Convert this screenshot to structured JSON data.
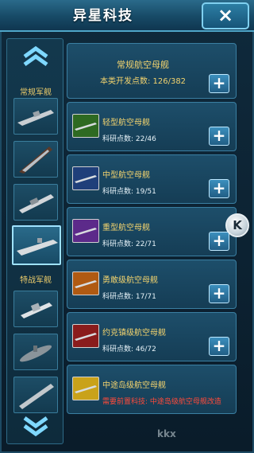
{
  "window": {
    "title": "异星科技",
    "close_label": "×"
  },
  "sidebar": {
    "up_arrow_icon": "chevron-up-double",
    "down_arrow_icon": "chevron-down-double",
    "categories": [
      {
        "label": "常规军舰"
      },
      {
        "label": "特战军舰"
      }
    ],
    "selected_index": 3
  },
  "header": {
    "name": "常规航空母舰",
    "points": "本类开发点数: 126/382",
    "plus_label": "+"
  },
  "ships": [
    {
      "name": "轻型航空母舰",
      "points": "科研点数: 22/46",
      "thumb_color": "#2e6a22",
      "plus_label": "+"
    },
    {
      "name": "中型航空母舰",
      "points": "科研点数: 19/51",
      "thumb_color": "#1f3f7a",
      "plus_label": "+"
    },
    {
      "name": "重型航空母舰",
      "points": "科研点数: 22/71",
      "thumb_color": "#5c2a8a",
      "plus_label": "+"
    },
    {
      "name": "勇敢级航空母舰",
      "points": "科研点数: 17/71",
      "thumb_color": "#b05a12",
      "plus_label": "+"
    },
    {
      "name": "约克镇级航空母舰",
      "points": "科研点数: 46/72",
      "thumb_color": "#8a1c1c",
      "plus_label": "+"
    },
    {
      "name": "中途岛级航空母舰",
      "requirement": "需要前置科技: 中途岛级航空母舰改造",
      "thumb_color": "#c9a21a"
    }
  ],
  "badge": {
    "label": "K"
  },
  "watermark": {
    "text": "kkx"
  }
}
